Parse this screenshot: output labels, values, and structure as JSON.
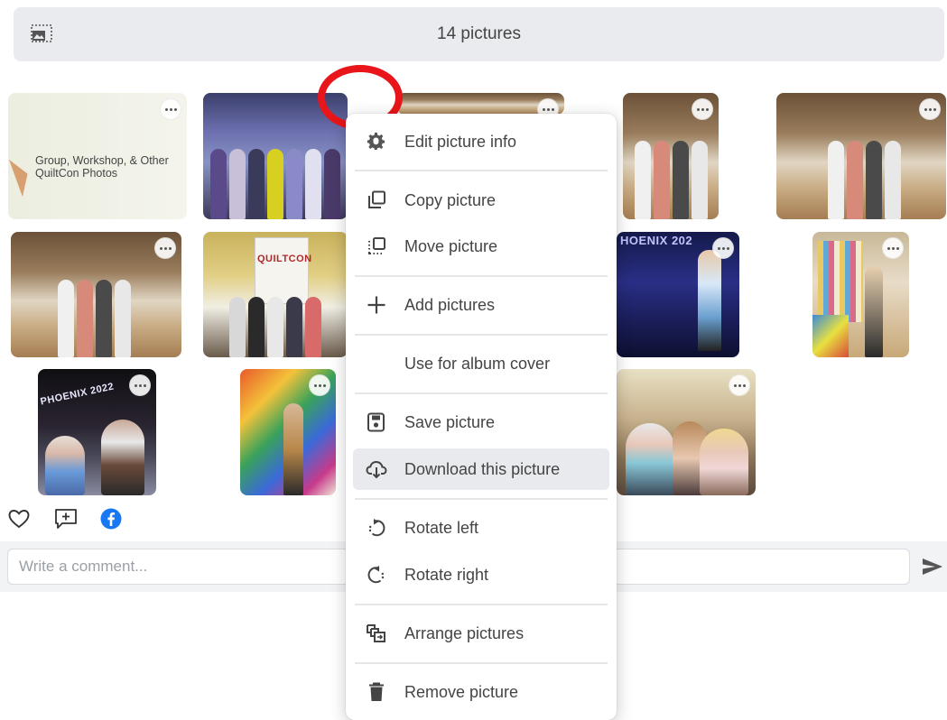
{
  "header": {
    "title": "14 pictures",
    "toggle_icon": "grid-view-icon"
  },
  "photos": {
    "title_card_text": "Group, Workshop, & Other\nQuiltCon Photos",
    "sign_quiltcon": "QUILTCON",
    "sign_phoenix": "HOENIX 202",
    "sign_phoenix_2022": "PHOENIX 2022"
  },
  "actions": {
    "like_icon": "heart-icon",
    "comment_icon": "add-comment-icon",
    "share_icon": "facebook-icon"
  },
  "comment": {
    "placeholder": "Write a comment...",
    "send_icon": "send-icon"
  },
  "menu": {
    "items": [
      {
        "label": "Edit picture info",
        "icon": "gear-icon"
      },
      {
        "label": "Copy picture",
        "icon": "copy-icon"
      },
      {
        "label": "Move picture",
        "icon": "move-icon"
      },
      {
        "label": "Add pictures",
        "icon": "plus-icon"
      },
      {
        "label": "Use for album cover",
        "icon": ""
      },
      {
        "label": "Save picture",
        "icon": "save-icon"
      },
      {
        "label": "Download this picture",
        "icon": "cloud-download-icon"
      },
      {
        "label": "Rotate left",
        "icon": "rotate-left-icon"
      },
      {
        "label": "Rotate right",
        "icon": "rotate-right-icon"
      },
      {
        "label": "Arrange pictures",
        "icon": "arrange-icon"
      },
      {
        "label": "Remove picture",
        "icon": "trash-icon"
      }
    ],
    "active_item": "Download this picture"
  },
  "colors": {
    "highlight_ring": "#e8151a",
    "facebook_blue": "#1877f2",
    "header_bg": "#e9ebee"
  }
}
